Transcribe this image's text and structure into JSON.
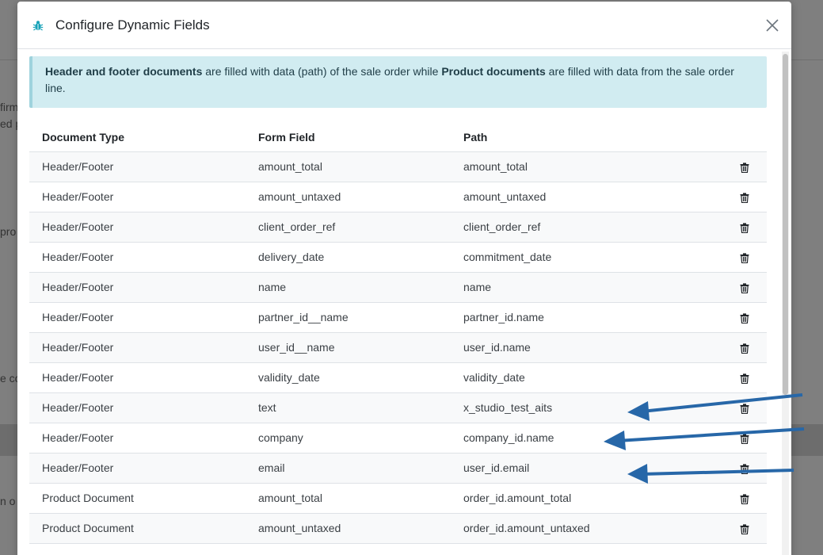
{
  "background": {
    "left_fragments": [
      "firm",
      "ed p",
      "pro",
      "e co",
      "n o"
    ]
  },
  "modal": {
    "title": "Configure Dynamic Fields",
    "icon": "bug-icon",
    "close_icon": "close-icon",
    "alert": {
      "bold1": "Header and footer documents",
      "text1": " are filled with data (path) of the sale order while ",
      "bold2": "Product documents",
      "text2": " are filled with data from the sale order line."
    },
    "table": {
      "headers": [
        "Document Type",
        "Form Field",
        "Path"
      ],
      "rows": [
        {
          "type": "Header/Footer",
          "form_field": "amount_total",
          "path": "amount_total"
        },
        {
          "type": "Header/Footer",
          "form_field": "amount_untaxed",
          "path": "amount_untaxed"
        },
        {
          "type": "Header/Footer",
          "form_field": "client_order_ref",
          "path": "client_order_ref"
        },
        {
          "type": "Header/Footer",
          "form_field": "delivery_date",
          "path": "commitment_date"
        },
        {
          "type": "Header/Footer",
          "form_field": "name",
          "path": "name"
        },
        {
          "type": "Header/Footer",
          "form_field": "partner_id__name",
          "path": "partner_id.name"
        },
        {
          "type": "Header/Footer",
          "form_field": "user_id__name",
          "path": "user_id.name"
        },
        {
          "type": "Header/Footer",
          "form_field": "validity_date",
          "path": "validity_date"
        },
        {
          "type": "Header/Footer",
          "form_field": "text",
          "path": "x_studio_test_aits"
        },
        {
          "type": "Header/Footer",
          "form_field": "company",
          "path": "company_id.name"
        },
        {
          "type": "Header/Footer",
          "form_field": "email",
          "path": "user_id.email"
        },
        {
          "type": "Product Document",
          "form_field": "amount_total",
          "path": "order_id.amount_total"
        },
        {
          "type": "Product Document",
          "form_field": "amount_untaxed",
          "path": "order_id.amount_untaxed"
        }
      ]
    }
  },
  "colors": {
    "alert_bg": "#d1ecf1",
    "icon_teal": "#17a2b8",
    "arrow_blue": "#2767a8"
  }
}
